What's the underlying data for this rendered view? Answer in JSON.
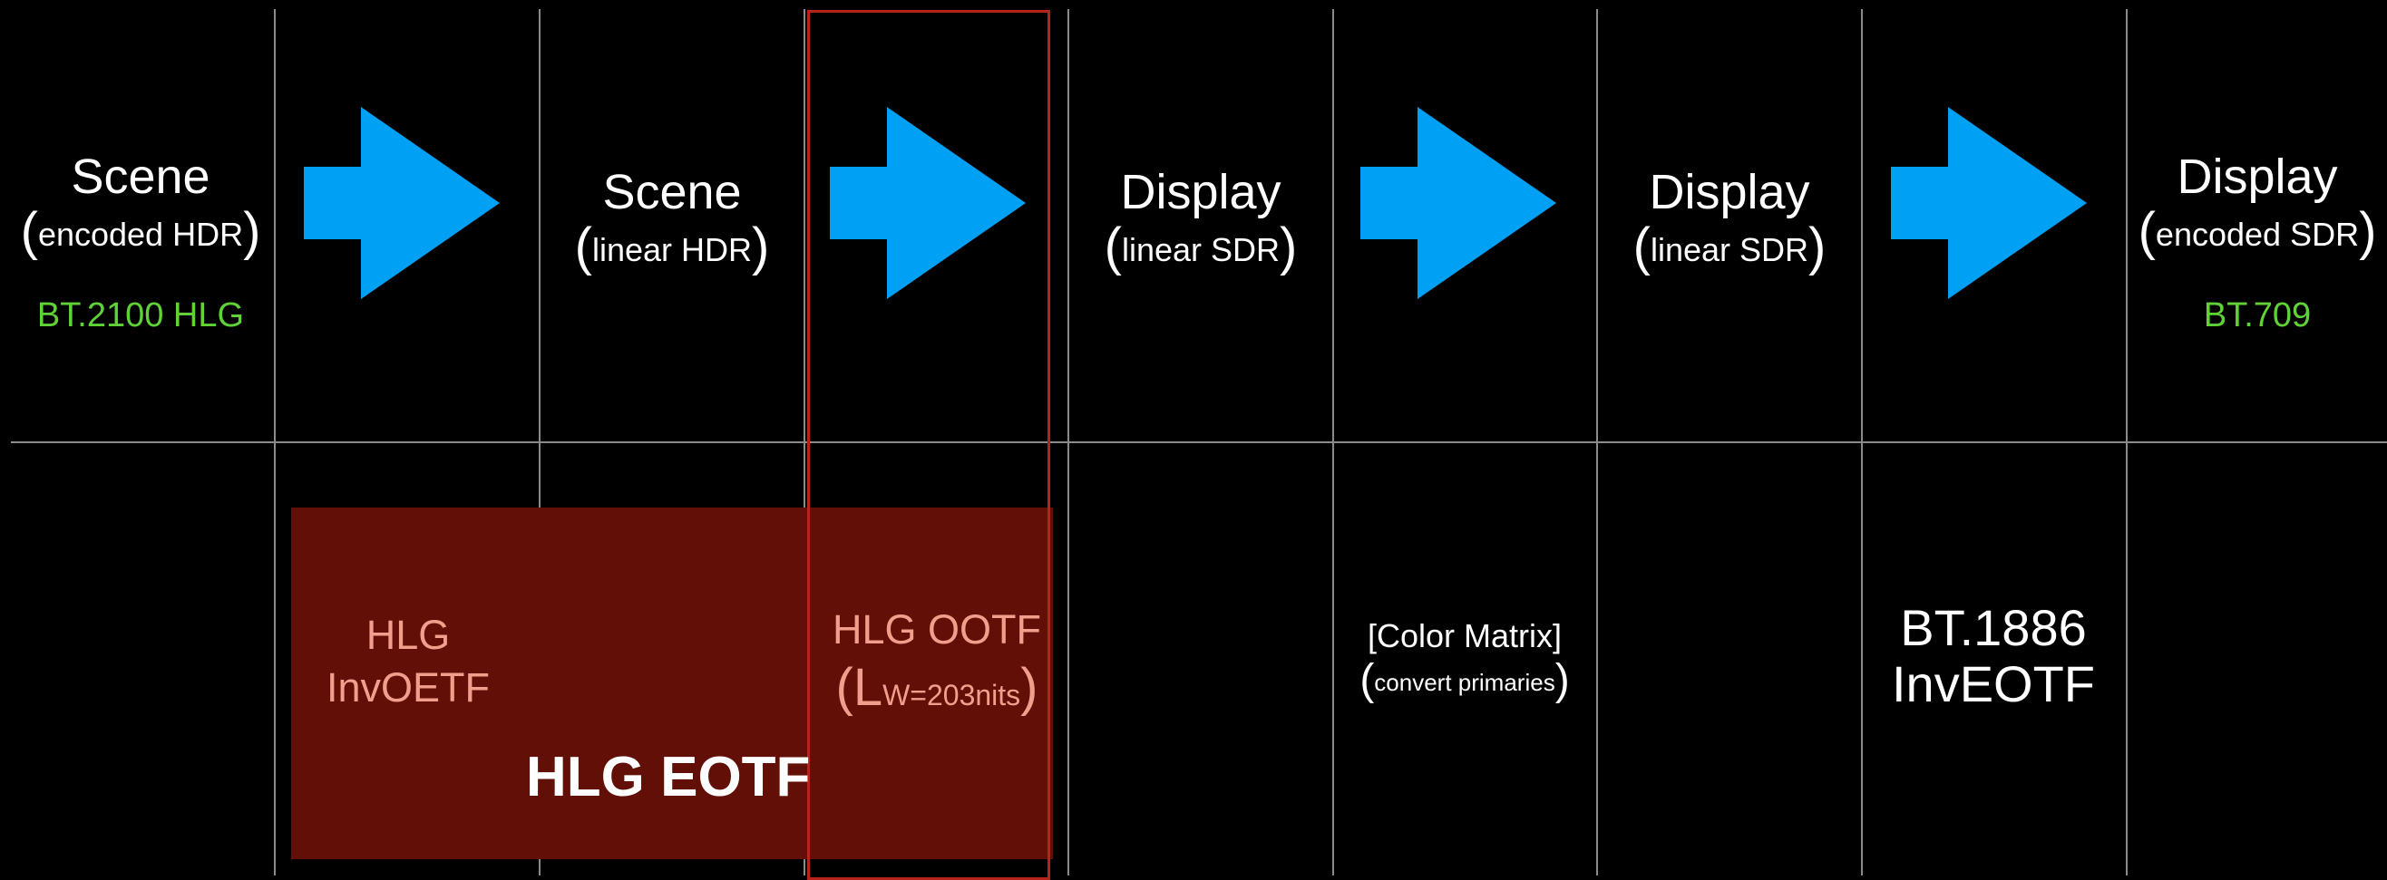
{
  "stages": [
    {
      "title": "Scene",
      "sub": "encoded HDR",
      "format": "BT.2100 HLG"
    },
    {
      "title": "Scene",
      "sub": "linear HDR"
    },
    {
      "title": "Display",
      "sub": "linear SDR"
    },
    {
      "title": "Display",
      "sub": "linear SDR"
    },
    {
      "title": "Display",
      "sub": "encoded SDR",
      "format": "BT.709"
    }
  ],
  "operations": {
    "hlg_inv_oetf": {
      "line1": "HLG",
      "line2": "InvOETF"
    },
    "hlg_ootf": {
      "line1": "HLG OOTF",
      "lw_prefix": "L",
      "lw_sub": "W=203nits"
    },
    "color_matrix": {
      "line1": "[Color Matrix]",
      "line2": "convert primaries"
    },
    "bt1886": {
      "line1": "BT.1886",
      "line2": "InvEOTF"
    }
  },
  "group_label": "HLG EOTF",
  "colors": {
    "background": "#000000",
    "arrow": "#00a0f5",
    "format_text": "#5fd336",
    "eotf_box": "#610f07",
    "ootf_outline": "#b5231a",
    "pink_text": "#f29e8d"
  },
  "icons": [
    "arrow-right-icon"
  ]
}
